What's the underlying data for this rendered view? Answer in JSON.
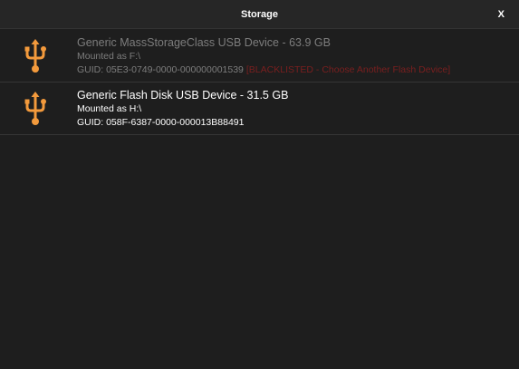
{
  "window": {
    "title": "Storage",
    "close_label": "X"
  },
  "devices": [
    {
      "name": "Generic MassStorageClass USB Device - 63.9 GB",
      "mounted": "Mounted as F:\\",
      "guid": "GUID: 05E3-0749-0000-000000001539",
      "note": "[BLACKLISTED - Choose Another Flash Device]",
      "enabled": false,
      "icon": "usb-icon"
    },
    {
      "name": "Generic Flash Disk USB Device - 31.5 GB",
      "mounted": "Mounted as H:\\",
      "guid": "GUID: 058F-6387-0000-000013B88491",
      "enabled": true,
      "icon": "usb-icon"
    }
  ],
  "colors": {
    "accent": "#f39a3c",
    "blacklist": "#7a1f1f",
    "background": "#1e1e1e"
  }
}
